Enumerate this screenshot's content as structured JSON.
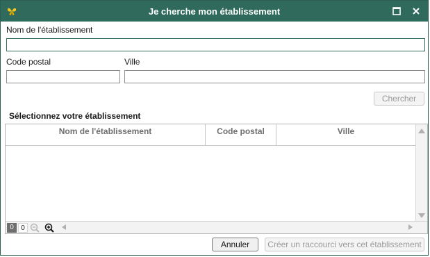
{
  "window": {
    "title": "Je cherche mon établissement",
    "icons": {
      "logo": "butterfly-logo-icon",
      "maximize": "maximize-icon",
      "close": "close-icon"
    },
    "colors": {
      "titlebar": "#2f6a5c",
      "logo": "#f0c419"
    }
  },
  "form": {
    "name_label": "Nom de l'établissement",
    "name_value": "",
    "postal_label": "Code postal",
    "postal_value": "",
    "city_label": "Ville",
    "city_value": "",
    "search_button": "Chercher"
  },
  "results": {
    "section_title": "Sélectionnez votre établissement",
    "columns": [
      "Nom de l'établissement",
      "Code postal",
      "Ville"
    ],
    "rows": [],
    "selected_count": "0",
    "total_count": "0",
    "icons": {
      "zoom_out": "zoom-out-icon",
      "zoom_in": "zoom-in-icon"
    }
  },
  "footer": {
    "cancel_button": "Annuler",
    "create_shortcut_button": "Créer un raccourci vers cet établissement"
  }
}
